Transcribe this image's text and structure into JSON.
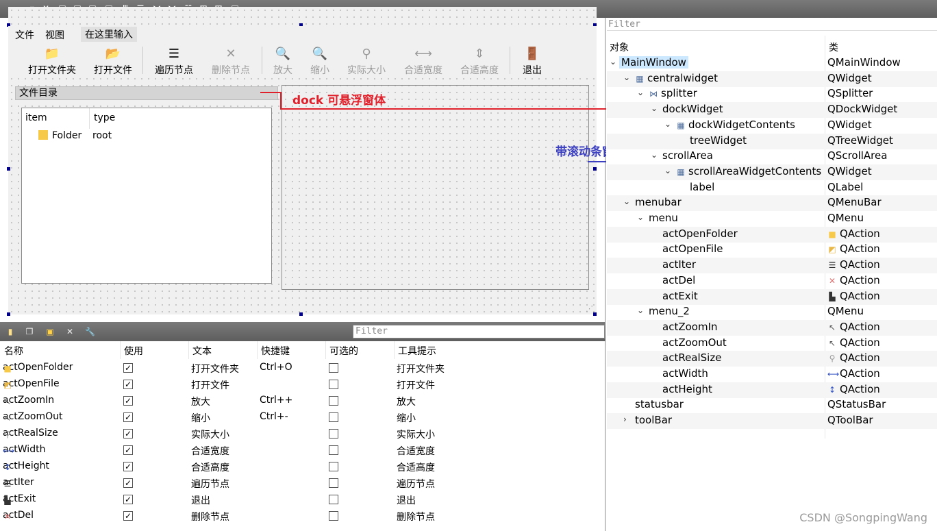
{
  "form": {
    "menubar": [
      "文件",
      "视图",
      "在这里输入"
    ],
    "toolbar": [
      {
        "label": "打开文件夹",
        "icon": "folder-icon",
        "glyph": "📁",
        "enabled": true
      },
      {
        "label": "打开文件",
        "icon": "open-file-icon",
        "glyph": "📂",
        "enabled": true
      },
      {
        "label": "遍历节点",
        "icon": "list-icon",
        "glyph": "☰",
        "enabled": true
      },
      {
        "label": "删除节点",
        "icon": "delete-icon",
        "glyph": "✕",
        "enabled": false
      },
      {
        "label": "放大",
        "icon": "zoom-in-icon",
        "glyph": "🔍",
        "enabled": false
      },
      {
        "label": "缩小",
        "icon": "zoom-out-icon",
        "glyph": "🔍",
        "enabled": false
      },
      {
        "label": "实际大小",
        "icon": "real-size-icon",
        "glyph": "⚲",
        "enabled": false
      },
      {
        "label": "合适宽度",
        "icon": "width-icon",
        "glyph": "⟷",
        "enabled": false
      },
      {
        "label": "合适高度",
        "icon": "height-icon",
        "glyph": "⇕",
        "enabled": false
      },
      {
        "label": "退出",
        "icon": "exit-icon",
        "glyph": "🚪",
        "enabled": true
      }
    ],
    "dock_title": "文件目录",
    "tree": {
      "headers": [
        "item",
        "type"
      ],
      "rows": [
        {
          "item": "Folder",
          "type": "root"
        }
      ]
    }
  },
  "annotations": {
    "dock": "dock 可悬浮窗体",
    "scroll": "带滚动条窗体",
    "dock_color": "#e0202a",
    "scroll_color": "#3b3fc0"
  },
  "action_editor": {
    "filter_placeholder": "Filter",
    "headers": [
      "名称",
      "使用",
      "文本",
      "快捷键",
      "可选的",
      "工具提示"
    ],
    "rows": [
      {
        "name": "actOpenFolder",
        "used": true,
        "text": "打开文件夹",
        "shortcut": "Ctrl+O",
        "checkable": false,
        "tooltip": "打开文件夹",
        "icon": "folder-icon"
      },
      {
        "name": "actOpenFile",
        "used": true,
        "text": "打开文件",
        "shortcut": "",
        "checkable": false,
        "tooltip": "打开文件",
        "icon": "open-file-icon"
      },
      {
        "name": "actZoomIn",
        "used": true,
        "text": "放大",
        "shortcut": "Ctrl++",
        "checkable": false,
        "tooltip": "放大",
        "icon": "zoom-in-icon"
      },
      {
        "name": "actZoomOut",
        "used": true,
        "text": "缩小",
        "shortcut": "Ctrl+-",
        "checkable": false,
        "tooltip": "缩小",
        "icon": "zoom-out-icon"
      },
      {
        "name": "actRealSize",
        "used": true,
        "text": "实际大小",
        "shortcut": "",
        "checkable": false,
        "tooltip": "实际大小",
        "icon": "real-size-icon"
      },
      {
        "name": "actWidth",
        "used": true,
        "text": "合适宽度",
        "shortcut": "",
        "checkable": false,
        "tooltip": "合适宽度",
        "icon": "width-icon"
      },
      {
        "name": "actHeight",
        "used": true,
        "text": "合适高度",
        "shortcut": "",
        "checkable": false,
        "tooltip": "合适高度",
        "icon": "height-icon"
      },
      {
        "name": "actIter",
        "used": true,
        "text": "遍历节点",
        "shortcut": "",
        "checkable": false,
        "tooltip": "遍历节点",
        "icon": "list-icon"
      },
      {
        "name": "actExit",
        "used": true,
        "text": "退出",
        "shortcut": "",
        "checkable": false,
        "tooltip": "退出",
        "icon": "exit-icon"
      },
      {
        "name": "actDel",
        "used": true,
        "text": "删除节点",
        "shortcut": "",
        "checkable": false,
        "tooltip": "删除节点",
        "icon": "delete-icon"
      }
    ]
  },
  "inspector": {
    "filter_placeholder": "Filter",
    "headers": [
      "对象",
      "类"
    ],
    "rows": [
      {
        "obj": "MainWindow",
        "cls": "QMainWindow",
        "level": 0,
        "arrow": "expanded",
        "selected": true
      },
      {
        "obj": "centralwidget",
        "cls": "QWidget",
        "level": 1,
        "arrow": "expanded",
        "obj_icon": "grid-layout-icon"
      },
      {
        "obj": "splitter",
        "cls": "QSplitter",
        "level": 2,
        "arrow": "expanded",
        "obj_icon": "splitter-icon"
      },
      {
        "obj": "dockWidget",
        "cls": "QDockWidget",
        "level": 3,
        "arrow": "expanded"
      },
      {
        "obj": "dockWidgetContents",
        "cls": "QWidget",
        "level": 4,
        "arrow": "expanded",
        "obj_icon": "grid-layout-icon"
      },
      {
        "obj": "treeWidget",
        "cls": "QTreeWidget",
        "level": 5,
        "arrow": "none"
      },
      {
        "obj": "scrollArea",
        "cls": "QScrollArea",
        "level": 3,
        "arrow": "expanded"
      },
      {
        "obj": "scrollAreaWidgetContents",
        "cls": "QWidget",
        "level": 4,
        "arrow": "expanded",
        "obj_icon": "grid-layout-icon"
      },
      {
        "obj": "label",
        "cls": "QLabel",
        "level": 5,
        "arrow": "none"
      },
      {
        "obj": "menubar",
        "cls": "QMenuBar",
        "level": 1,
        "arrow": "expanded"
      },
      {
        "obj": "menu",
        "cls": "QMenu",
        "level": 2,
        "arrow": "expanded"
      },
      {
        "obj": "actOpenFolder",
        "cls": "QAction",
        "level": 3,
        "arrow": "none",
        "cls_icon": "folder-icon"
      },
      {
        "obj": "actOpenFile",
        "cls": "QAction",
        "level": 3,
        "arrow": "none",
        "cls_icon": "open-file-icon"
      },
      {
        "obj": "actIter",
        "cls": "QAction",
        "level": 3,
        "arrow": "none",
        "cls_icon": "list-icon"
      },
      {
        "obj": "actDel",
        "cls": "QAction",
        "level": 3,
        "arrow": "none",
        "cls_icon": "delete-icon"
      },
      {
        "obj": "actExit",
        "cls": "QAction",
        "level": 3,
        "arrow": "none",
        "cls_icon": "exit-icon"
      },
      {
        "obj": "menu_2",
        "cls": "QMenu",
        "level": 2,
        "arrow": "expanded"
      },
      {
        "obj": "actZoomIn",
        "cls": "QAction",
        "level": 3,
        "arrow": "none",
        "cls_icon": "zoom-in-icon"
      },
      {
        "obj": "actZoomOut",
        "cls": "QAction",
        "level": 3,
        "arrow": "none",
        "cls_icon": "zoom-out-icon"
      },
      {
        "obj": "actRealSize",
        "cls": "QAction",
        "level": 3,
        "arrow": "none",
        "cls_icon": "real-size-icon"
      },
      {
        "obj": "actWidth",
        "cls": "QAction",
        "level": 3,
        "arrow": "none",
        "cls_icon": "width-icon"
      },
      {
        "obj": "actHeight",
        "cls": "QAction",
        "level": 3,
        "arrow": "none",
        "cls_icon": "height-icon"
      },
      {
        "obj": "statusbar",
        "cls": "QStatusBar",
        "level": 1,
        "arrow": "none"
      },
      {
        "obj": "toolBar",
        "cls": "QToolBar",
        "level": 1,
        "arrow": "collapsed"
      }
    ]
  },
  "watermark": "CSDN @SongpingWang"
}
